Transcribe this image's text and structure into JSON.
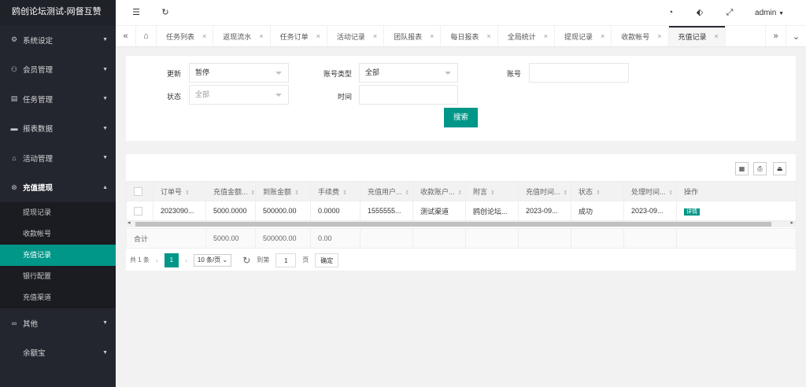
{
  "logo": "鸥创论坛测试-网督互赞",
  "header": {
    "admin_label": "admin"
  },
  "sidebar": {
    "menu1": "系统设定",
    "menu2": "会员管理",
    "menu3": "任务管理",
    "menu4": "报表数据",
    "menu5": "活动管理",
    "menu6": "充值提现",
    "sub1": "提现记录",
    "sub2": "收款帐号",
    "sub3": "充值记录",
    "sub4": "银行配置",
    "sub5": "充值渠道",
    "menu7": "其他",
    "menu8": "余额宝"
  },
  "tabs": {
    "t1": "任务列表",
    "t2": "返现流水",
    "t3": "任务订单",
    "t4": "活动记录",
    "t5": "团队报表",
    "t6": "每日报表",
    "t7": "全局统计",
    "t8": "提现记录",
    "t9": "收款帐号",
    "t10": "充值记录"
  },
  "filter": {
    "update_label": "更新",
    "update_value": "暂停",
    "account_type_label": "账号类型",
    "account_type_value": "全部",
    "account_label": "账号",
    "status_label": "状态",
    "status_value": "全部",
    "time_label": "时间",
    "search_button": "搜索"
  },
  "table": {
    "h1": "订单号",
    "h2": "充值金额...",
    "h3": "到账金额",
    "h4": "手续费",
    "h5": "充值用户...",
    "h6": "收款账户...",
    "h7": "附言",
    "h8": "充值时间...",
    "h9": "状态",
    "h10": "处理时间...",
    "h11": "操作",
    "r1": {
      "c1": "2023090...",
      "c2": "5000.0000",
      "c3": "500000.00",
      "c4": "0.0000",
      "c5": "1555555...",
      "c6": "测试渠道",
      "c7": "鸥创论坛...",
      "c8": "2023-09...",
      "c9": "成功",
      "c10": "2023-09...",
      "detail": "详情"
    },
    "total_label": "合计",
    "total_c2": "5000.00",
    "total_c3": "500000.00",
    "total_c4": "0.00"
  },
  "pager": {
    "total_text": "共 1 条",
    "current_page": "1",
    "page_size": "10 条/页",
    "goto_label": "到第",
    "goto_value": "1",
    "page_unit": "页",
    "confirm": "确定"
  }
}
